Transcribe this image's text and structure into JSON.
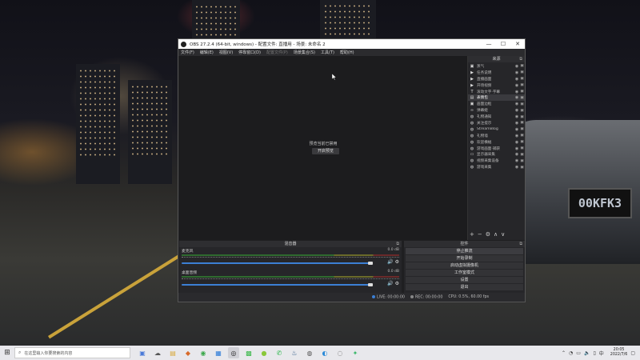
{
  "window": {
    "title": "OBS 27.2.4 (64-bit, windows) - 配置文件: 直播用 - 场景: 未命名 2",
    "controls": [
      "—",
      "☐",
      "✕"
    ]
  },
  "menu": [
    {
      "label": "文件(F)",
      "enabled": true
    },
    {
      "label": "编辑(E)",
      "enabled": true
    },
    {
      "label": "视图(V)",
      "enabled": true
    },
    {
      "label": "停靠窗口(D)",
      "enabled": true
    },
    {
      "label": "配置文件(P)",
      "enabled": false
    },
    {
      "label": "场景集合(S)",
      "enabled": true
    },
    {
      "label": "工具(T)",
      "enabled": true
    },
    {
      "label": "帮助(H)",
      "enabled": true
    }
  ],
  "preview": {
    "message": "预览当前已禁用",
    "enable_button": "开启预览"
  },
  "sources": {
    "header": "来源",
    "items": [
      {
        "icon": "image-icon",
        "label": "蒸气",
        "selected": false
      },
      {
        "icon": "play-icon",
        "label": "任务说明",
        "selected": false
      },
      {
        "icon": "play-icon",
        "label": "直播画面",
        "selected": false
      },
      {
        "icon": "play-icon",
        "label": "开场视频",
        "selected": false
      },
      {
        "icon": "text-icon",
        "label": "滚动文字·字幕",
        "selected": false
      },
      {
        "icon": "folder-icon",
        "label": "表情包",
        "selected": true
      },
      {
        "icon": "image-icon",
        "label": "画面边框",
        "selected": false
      },
      {
        "icon": "link-icon",
        "label": "弹幕姬",
        "selected": false
      },
      {
        "icon": "globe-icon",
        "label": "礼物通知",
        "selected": false
      },
      {
        "icon": "globe-icon",
        "label": "关注提示",
        "selected": false
      },
      {
        "icon": "globe-icon",
        "label": "StreamBlog",
        "selected": false
      },
      {
        "icon": "globe-icon",
        "label": "礼物墙",
        "selected": false
      },
      {
        "icon": "globe-icon",
        "label": "欢迎横幅",
        "selected": false
      },
      {
        "icon": "globe-icon",
        "label": "游戏画面·捕获",
        "selected": false
      },
      {
        "icon": "monitor-icon",
        "label": "显示器采集",
        "selected": false
      },
      {
        "icon": "globe-icon",
        "label": "视频采集设备",
        "selected": false
      },
      {
        "icon": "globe-icon",
        "label": "游戏采集",
        "selected": false
      }
    ],
    "toolbar": [
      "+",
      "−",
      "⚙",
      "∧",
      "∨"
    ]
  },
  "mixer": {
    "header": "混音器",
    "tracks": [
      {
        "name": "麦克风",
        "db": "0.0 dB",
        "volume": 0.98
      },
      {
        "name": "桌面音频",
        "db": "0.0 dB",
        "volume": 0.98
      }
    ]
  },
  "controls": {
    "header": "控件",
    "buttons": [
      {
        "label": "停止推流",
        "active": true
      },
      {
        "label": "开始录制",
        "active": false
      },
      {
        "label": "启动虚拟摄像机",
        "active": false
      },
      {
        "label": "工作室模式",
        "active": false
      },
      {
        "label": "设置",
        "active": false
      },
      {
        "label": "退出",
        "active": false
      }
    ]
  },
  "status": {
    "live": "LIVE: 00:00:00",
    "rec": "REC: 00:00:00",
    "cpu": "CPU: 0.5%, 60.00 fps"
  },
  "taskbar": {
    "search_placeholder": "在这里输入你要搜索的内容",
    "time": "20:05",
    "date": "2022/7/6"
  }
}
